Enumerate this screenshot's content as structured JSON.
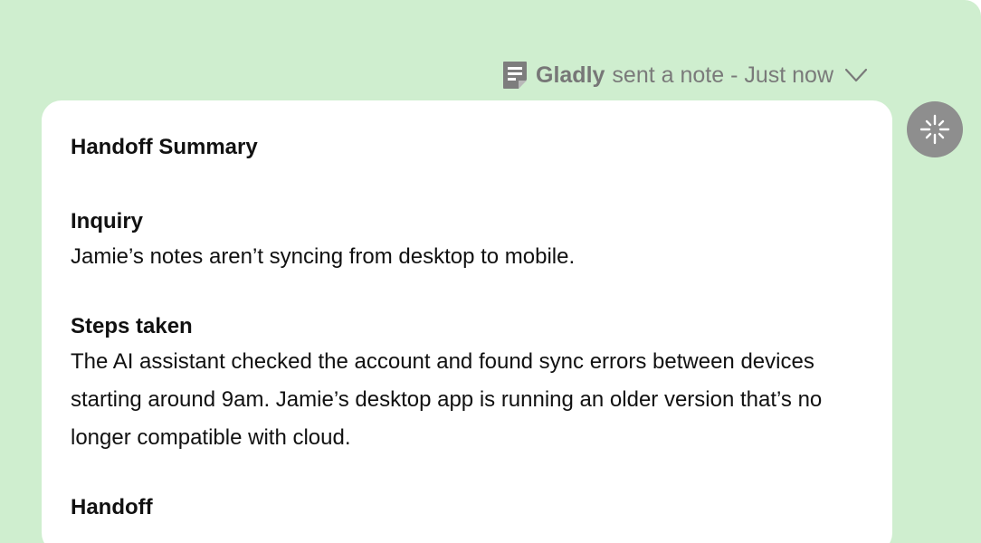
{
  "note_header": {
    "sender": "Gladly",
    "action_text": "sent a note - Just now",
    "icon": "note-icon",
    "expand_icon": "chevron-down-icon"
  },
  "summary": {
    "title": "Handoff Summary",
    "sections": [
      {
        "heading": "Inquiry",
        "body": "Jamie’s notes aren’t syncing from desktop to mobile."
      },
      {
        "heading": "Steps taken",
        "body": "The AI assistant checked the account and found sync errors between devices starting around 9am. Jamie’s desktop app is running an older version that’s no longer compatible with cloud."
      },
      {
        "heading": "Handoff",
        "body": ""
      }
    ]
  },
  "avatar": {
    "icon": "sparkle-icon"
  },
  "colors": {
    "panel_background": "#cfeecf",
    "card_background": "#ffffff",
    "meta_text": "#7a7a7a",
    "avatar_background": "#8e8e8e"
  }
}
